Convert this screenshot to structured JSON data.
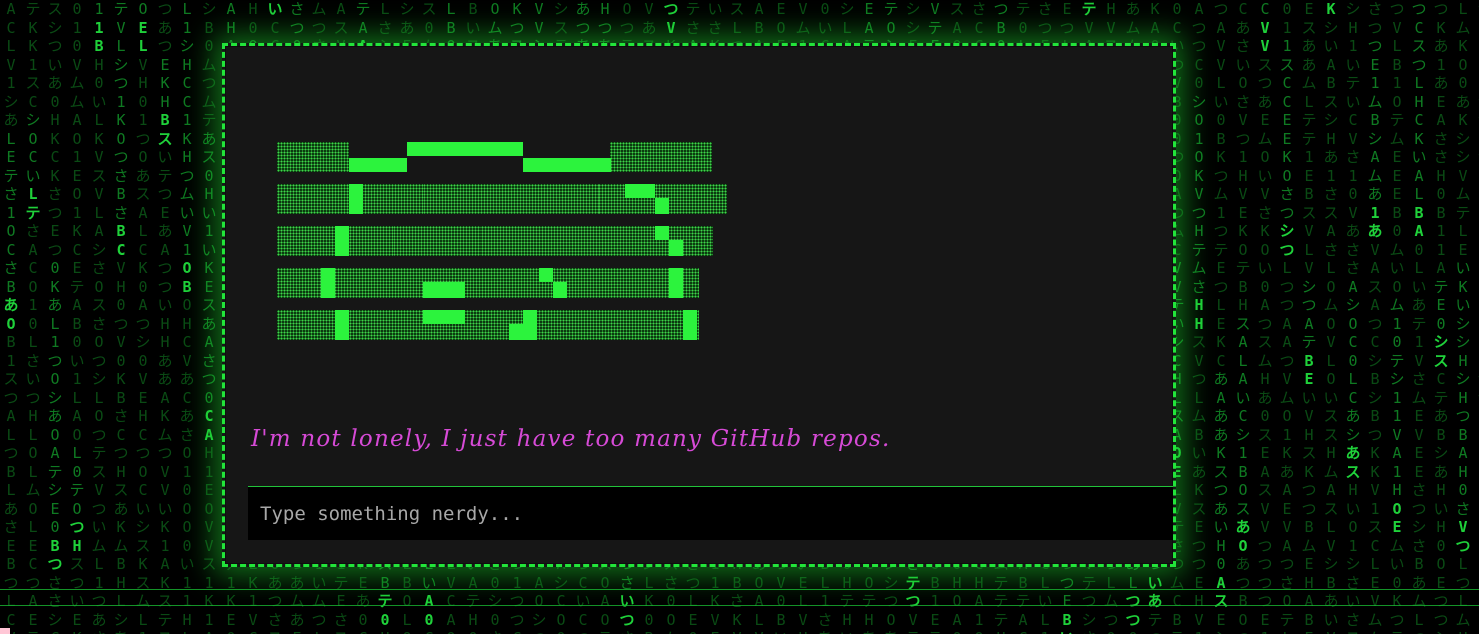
{
  "background": {
    "effect": "matrix-rain",
    "glyph_color": "#1fd13a"
  },
  "panel": {
    "border_color": "#22e53a",
    "background": "#161616",
    "logo_icon": "pixel-art-ascii-logo"
  },
  "message": {
    "text": "I'm not lonely, I just have too many GitHub repos.",
    "color": "#d64ad6"
  },
  "input": {
    "value": "",
    "placeholder": "Type something nerdy..."
  }
}
